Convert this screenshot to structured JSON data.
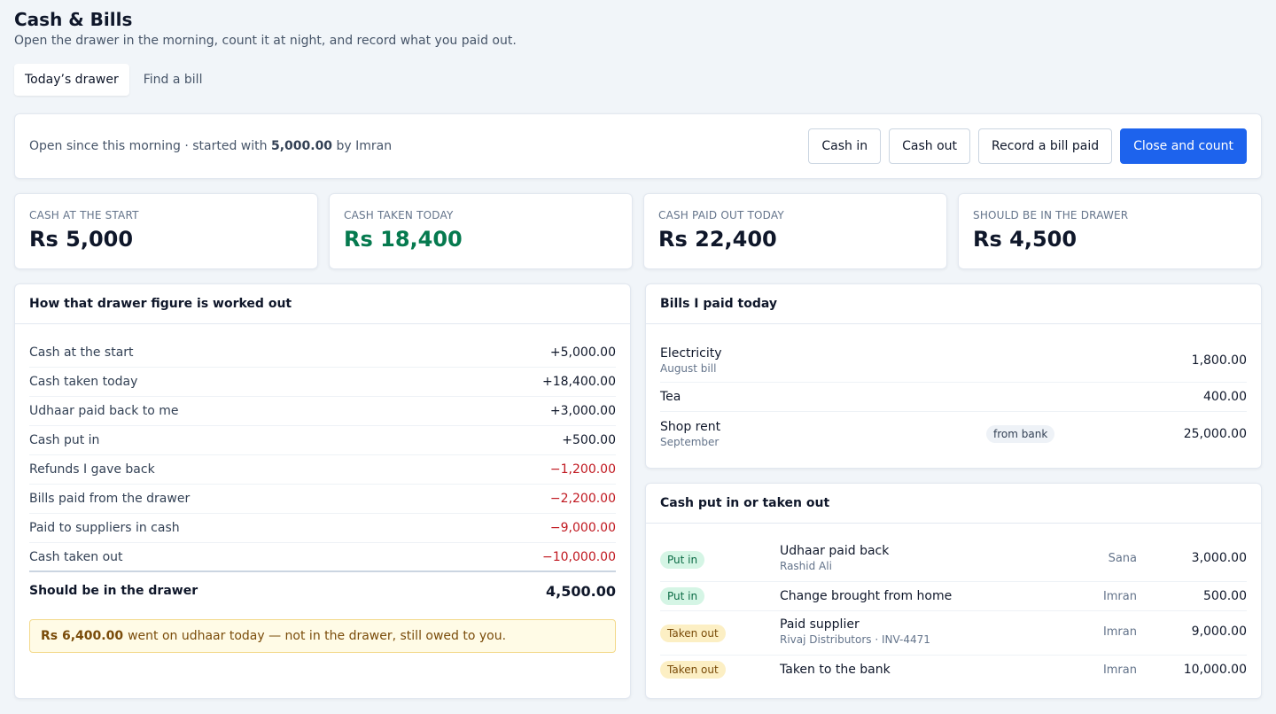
{
  "header": {
    "title": "Cash & Bills",
    "subtitle": "Open the drawer in the morning, count it at night, and record what you paid out."
  },
  "tabs": [
    {
      "label": "Today’s drawer",
      "active": true
    },
    {
      "label": "Find a bill",
      "active": false
    }
  ],
  "status": {
    "prefix": "Open since this morning · started with",
    "amount": "5,000.00",
    "by": "by Imran",
    "actions": {
      "cash_in": "Cash in",
      "cash_out": "Cash out",
      "record_bill": "Record a bill paid",
      "close": "Close and count"
    }
  },
  "stats": [
    {
      "label": "Cash at the start",
      "value": "Rs 5,000"
    },
    {
      "label": "Cash taken today",
      "value": "Rs 18,400"
    },
    {
      "label": "Cash paid out today",
      "value": "Rs 22,400"
    },
    {
      "label": "Should be in the drawer",
      "value": "Rs 4,500"
    }
  ],
  "calc": {
    "title": "How that drawer figure is worked out",
    "rows": [
      {
        "label": "Cash at the start",
        "amount": "+5,000.00"
      },
      {
        "label": "Cash taken today",
        "amount": "+18,400.00"
      },
      {
        "label": "Udhaar paid back to me",
        "amount": "+3,000.00"
      },
      {
        "label": "Cash put in",
        "amount": "+500.00"
      },
      {
        "label": "Refunds I gave back",
        "amount": "−1,200.00"
      },
      {
        "label": "Bills paid from the drawer",
        "amount": "−2,200.00"
      },
      {
        "label": "Paid to suppliers in cash",
        "amount": "−9,000.00"
      },
      {
        "label": "Cash taken out",
        "amount": "−10,000.00"
      }
    ],
    "total_label": "Should be in the drawer",
    "total_amount": "4,500.00",
    "note_amount": "Rs 6,400.00",
    "note_text": "went on udhaar today — not in the drawer, still owed to you."
  },
  "bills": {
    "title": "Bills I paid today",
    "rows": [
      {
        "name": "Electricity",
        "sub": "August bill",
        "tag": "",
        "amount": "1,800.00"
      },
      {
        "name": "Tea",
        "sub": "",
        "tag": "",
        "amount": "400.00"
      },
      {
        "name": "Shop rent",
        "sub": "September",
        "tag": "from bank",
        "amount": "25,000.00"
      }
    ]
  },
  "movements": {
    "title": "Cash put in or taken out",
    "rows": [
      {
        "type": "Put in",
        "kind": "in",
        "desc": "Udhaar paid back",
        "sub": "Rashid Ali",
        "who": "Sana",
        "amount": "3,000.00"
      },
      {
        "type": "Put in",
        "kind": "in",
        "desc": "Change brought from home",
        "sub": "",
        "who": "Imran",
        "amount": "500.00"
      },
      {
        "type": "Taken out",
        "kind": "out",
        "desc": "Paid supplier",
        "sub": "Rivaj Distributors · INV-4471",
        "who": "Imran",
        "amount": "9,000.00"
      },
      {
        "type": "Taken out",
        "kind": "out",
        "desc": "Taken to the bank",
        "sub": "",
        "who": "Imran",
        "amount": "10,000.00"
      }
    ]
  }
}
